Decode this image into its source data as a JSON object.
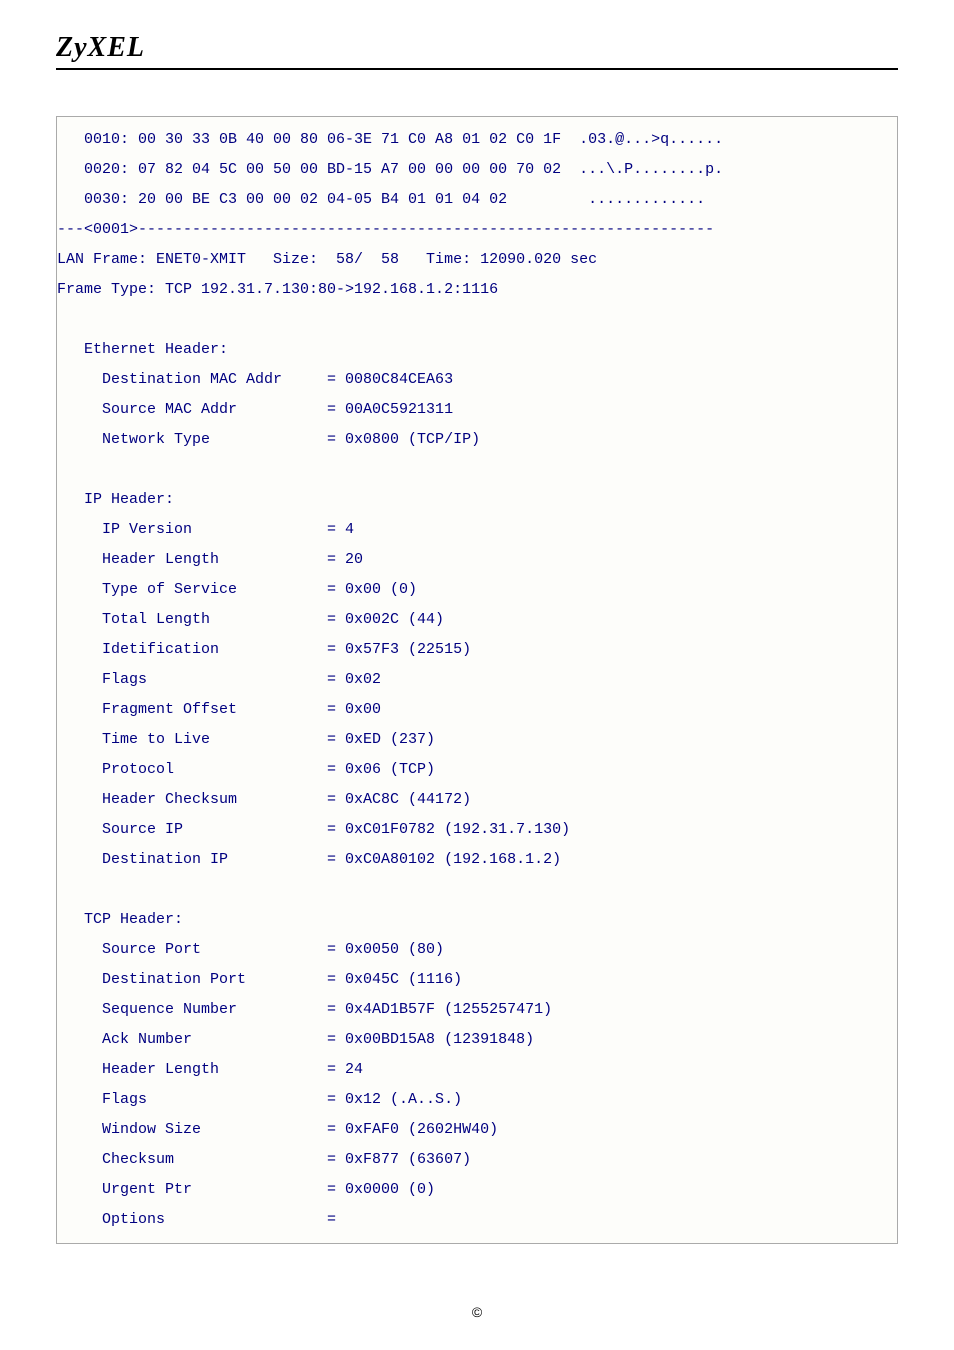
{
  "brand": "ZyXEL",
  "footer": "©",
  "hexdump": [
    "   0010: 00 30 33 0B 40 00 80 06-3E 71 C0 A8 01 02 C0 1F  .03.@...>q......",
    "   0020: 07 82 04 5C 00 50 00 BD-15 A7 00 00 00 00 70 02  ...\\.P........p.",
    "   0030: 20 00 BE C3 00 00 02 04-05 B4 01 01 04 02         ............."
  ],
  "separator": "---<0001>----------------------------------------------------------------",
  "lan_frame": "LAN Frame: ENET0-XMIT   Size:  58/  58   Time: 12090.020 sec",
  "frame_type": "Frame Type: TCP 192.31.7.130:80->192.168.1.2:1116",
  "sections": [
    {
      "title": "   Ethernet Header:",
      "rows": [
        {
          "label": "     Destination MAC Addr",
          "value": "= 0080C84CEA63"
        },
        {
          "label": "     Source MAC Addr",
          "value": "= 00A0C5921311"
        },
        {
          "label": "     Network Type",
          "value": "= 0x0800 (TCP/IP)"
        }
      ]
    },
    {
      "title": "   IP Header:",
      "rows": [
        {
          "label": "     IP Version",
          "value": "= 4"
        },
        {
          "label": "     Header Length",
          "value": "= 20"
        },
        {
          "label": "     Type of Service",
          "value": "= 0x00 (0)"
        },
        {
          "label": "     Total Length",
          "value": "= 0x002C (44)"
        },
        {
          "label": "     Idetification",
          "value": "= 0x57F3 (22515)"
        },
        {
          "label": "     Flags",
          "value": "= 0x02"
        },
        {
          "label": "     Fragment Offset",
          "value": "= 0x00"
        },
        {
          "label": "     Time to Live",
          "value": "= 0xED (237)"
        },
        {
          "label": "     Protocol",
          "value": "= 0x06 (TCP)"
        },
        {
          "label": "     Header Checksum",
          "value": "= 0xAC8C (44172)"
        },
        {
          "label": "     Source IP",
          "value": "= 0xC01F0782 (192.31.7.130)"
        },
        {
          "label": "     Destination IP",
          "value": "= 0xC0A80102 (192.168.1.2)"
        }
      ]
    },
    {
      "title": "   TCP Header:",
      "rows": [
        {
          "label": "     Source Port",
          "value": "= 0x0050 (80)"
        },
        {
          "label": "     Destination Port",
          "value": "= 0x045C (1116)"
        },
        {
          "label": "     Sequence Number",
          "value": "= 0x4AD1B57F (1255257471)"
        },
        {
          "label": "     Ack Number",
          "value": "= 0x00BD15A8 (12391848)"
        },
        {
          "label": "     Header Length",
          "value": "= 24"
        },
        {
          "label": "     Flags",
          "value": "= 0x12 (.A..S.)"
        },
        {
          "label": "     Window Size",
          "value": "= 0xFAF0 (2602HW40)"
        },
        {
          "label": "     Checksum",
          "value": "= 0xF877 (63607)"
        },
        {
          "label": "     Urgent Ptr",
          "value": "= 0x0000 (0)"
        },
        {
          "label": "     Options",
          "value": "="
        }
      ]
    }
  ]
}
